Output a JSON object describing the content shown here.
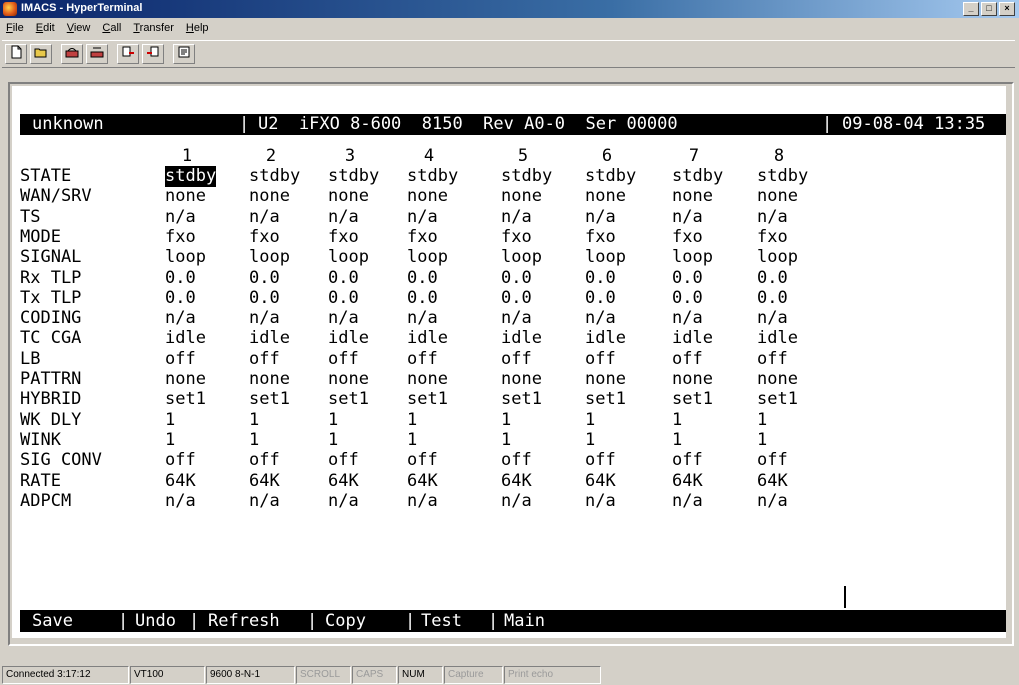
{
  "window": {
    "title": "IMACS - HyperTerminal",
    "min": "_",
    "max": "□",
    "close": "×"
  },
  "menubar": [
    {
      "ul": "F",
      "rest": "ile"
    },
    {
      "ul": "E",
      "rest": "dit"
    },
    {
      "ul": "V",
      "rest": "iew"
    },
    {
      "ul": "C",
      "rest": "all"
    },
    {
      "ul": "T",
      "rest": "ransfer"
    },
    {
      "ul": "H",
      "rest": "elp"
    }
  ],
  "toolbar": [
    "new-icon",
    "open-icon",
    "connect-icon",
    "disconnect-icon",
    "send-icon",
    "receive-icon",
    "properties-icon"
  ],
  "terminal": {
    "header": {
      "device": "unknown",
      "sep1": "|",
      "card": "U2  iFXO 8-600  8150  Rev A0-0  Ser 00000",
      "sep2": "|",
      "datetime": "09-08-04 13:35"
    },
    "columns": [
      "1",
      "2",
      "3",
      "4",
      "5",
      "6",
      "7",
      "8"
    ],
    "rows": [
      {
        "label": "STATE",
        "values": [
          "stdby",
          "stdby",
          "stdby",
          "stdby",
          "stdby",
          "stdby",
          "stdby",
          "stdby"
        ]
      },
      {
        "label": "WAN/SRV",
        "values": [
          "none",
          "none",
          "none",
          "none",
          "none",
          "none",
          "none",
          "none"
        ]
      },
      {
        "label": "TS",
        "values": [
          "n/a",
          "n/a",
          "n/a",
          "n/a",
          "n/a",
          "n/a",
          "n/a",
          "n/a"
        ]
      },
      {
        "label": "MODE",
        "values": [
          "fxo",
          "fxo",
          "fxo",
          "fxo",
          "fxo",
          "fxo",
          "fxo",
          "fxo"
        ]
      },
      {
        "label": "SIGNAL",
        "values": [
          "loop",
          "loop",
          "loop",
          "loop",
          "loop",
          "loop",
          "loop",
          "loop"
        ]
      },
      {
        "label": "Rx TLP",
        "values": [
          "0.0",
          "0.0",
          "0.0",
          "0.0",
          "0.0",
          "0.0",
          "0.0",
          "0.0"
        ]
      },
      {
        "label": "Tx TLP",
        "values": [
          "0.0",
          "0.0",
          "0.0",
          "0.0",
          "0.0",
          "0.0",
          "0.0",
          "0.0"
        ]
      },
      {
        "label": "CODING",
        "values": [
          "n/a",
          "n/a",
          "n/a",
          "n/a",
          "n/a",
          "n/a",
          "n/a",
          "n/a"
        ]
      },
      {
        "label": "TC CGA",
        "values": [
          "idle",
          "idle",
          "idle",
          "idle",
          "idle",
          "idle",
          "idle",
          "idle"
        ]
      },
      {
        "label": "LB",
        "values": [
          "off",
          "off",
          "off",
          "off",
          "off",
          "off",
          "off",
          "off"
        ]
      },
      {
        "label": "PATTRN",
        "values": [
          "none",
          "none",
          "none",
          "none",
          "none",
          "none",
          "none",
          "none"
        ]
      },
      {
        "label": "HYBRID",
        "values": [
          "set1",
          "set1",
          "set1",
          "set1",
          "set1",
          "set1",
          "set1",
          "set1"
        ]
      },
      {
        "label": "WK DLY",
        "values": [
          "1",
          "1",
          "1",
          "1",
          "1",
          "1",
          "1",
          "1"
        ]
      },
      {
        "label": "WINK",
        "values": [
          "1",
          "1",
          "1",
          "1",
          "1",
          "1",
          "1",
          "1"
        ]
      },
      {
        "label": "SIG CONV",
        "values": [
          "off",
          "off",
          "off",
          "off",
          "off",
          "off",
          "off",
          "off"
        ]
      },
      {
        "label": "RATE",
        "values": [
          "64K",
          "64K",
          "64K",
          "64K",
          "64K",
          "64K",
          "64K",
          "64K"
        ]
      },
      {
        "label": "ADPCM",
        "values": [
          "n/a",
          "n/a",
          "n/a",
          "n/a",
          "n/a",
          "n/a",
          "n/a",
          "n/a"
        ]
      }
    ],
    "commands": [
      "Save",
      "Undo",
      "Refresh",
      "Copy",
      "Test",
      "Main"
    ],
    "command_sep": "|"
  },
  "statusbar": {
    "connected": "Connected 3:17:12",
    "emulation": "VT100",
    "settings": "9600 8-N-1",
    "scroll": "SCROLL",
    "caps": "CAPS",
    "num": "NUM",
    "capture": "Capture",
    "print_echo": "Print echo"
  }
}
